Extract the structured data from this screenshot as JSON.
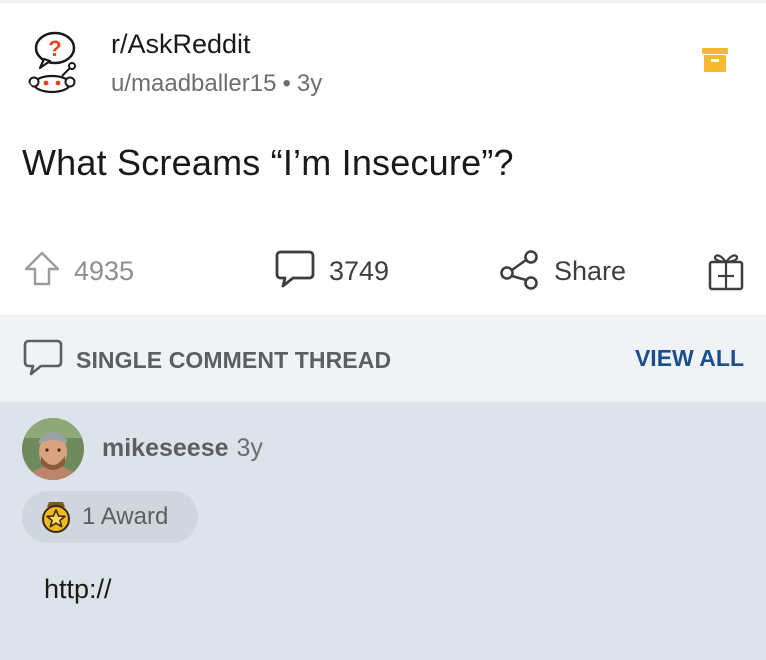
{
  "post": {
    "subreddit": "r/AskReddit",
    "author": "u/maadballer15",
    "separator": "•",
    "age": "3y",
    "title": "What Screams “I’m Insecure”?"
  },
  "actions": {
    "votes": "4935",
    "comments": "3749",
    "share": "Share"
  },
  "thread": {
    "label": "SINGLE COMMENT THREAD",
    "view_all": "VIEW ALL"
  },
  "comment": {
    "author": "mikeseese",
    "age": "3y",
    "award": "1 Award",
    "body": "http://"
  },
  "colors": {
    "save_icon": "#f5b82e",
    "link_blue": "#1b4e8c",
    "comment_bg": "#dde3ea",
    "thread_bg": "#f0f2f4"
  },
  "icons": [
    "subreddit-icon",
    "save-icon",
    "upvote-icon",
    "comment-icon",
    "share-icon",
    "gift-icon",
    "thread-comment-icon",
    "award-icon"
  ]
}
